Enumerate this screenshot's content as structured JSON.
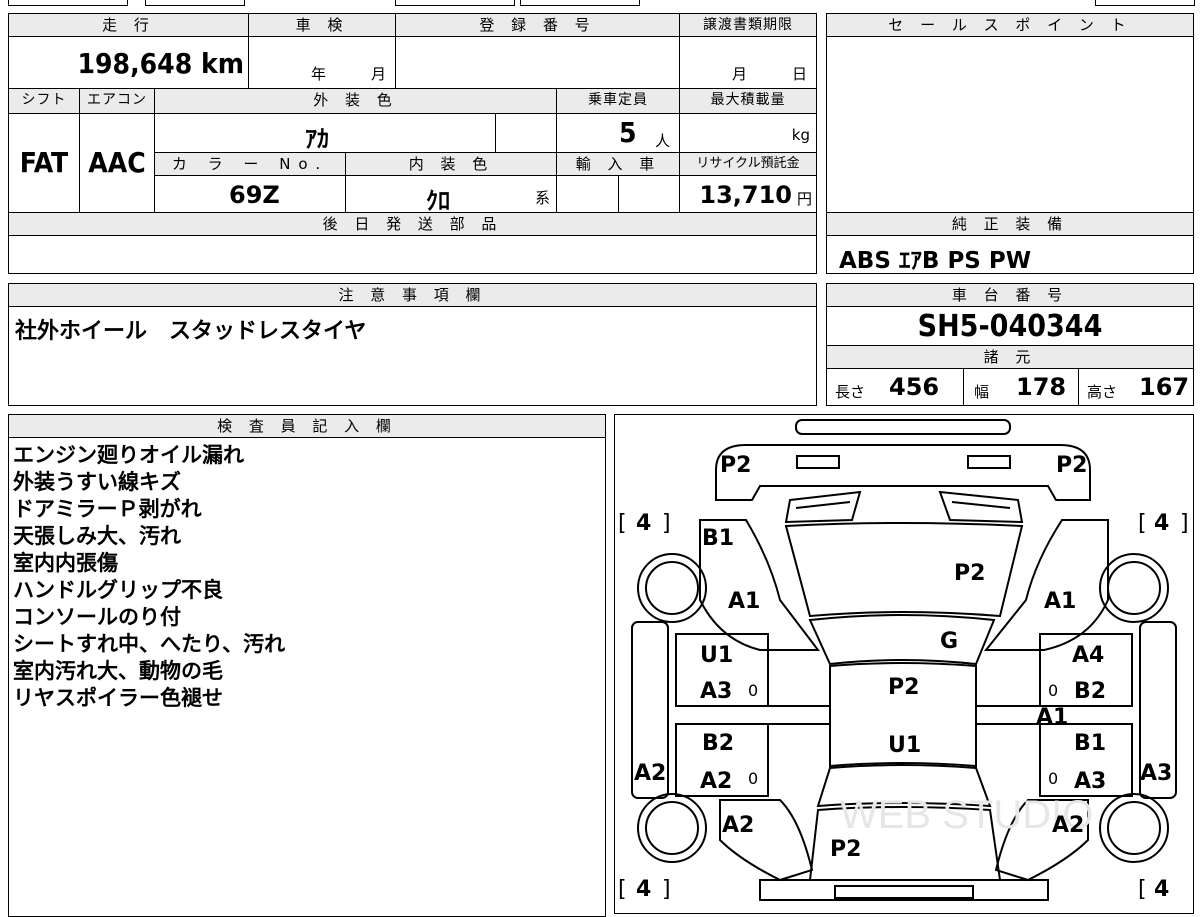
{
  "header": {
    "mileage_label": "走 行",
    "mileage_value": "198,648 km",
    "shaken_label": "車 検",
    "shaken_year_unit": "年",
    "shaken_month_unit": "月",
    "registration_label": "登 録 番 号",
    "transfer_label": "譲渡書類期限",
    "transfer_month_unit": "月",
    "transfer_day_unit": "日"
  },
  "specs": {
    "shift_label": "シフト",
    "shift_value": "FAT",
    "aircon_label": "エアコン",
    "aircon_value": "AAC",
    "exterior_color_label": "外 装 色",
    "exterior_color_value": "ｱｶ",
    "capacity_label": "乗車定員",
    "capacity_value": "5",
    "capacity_unit": "人",
    "max_load_label": "最大積載量",
    "max_load_unit": "kg",
    "color_no_label": "カ ラ ー No.",
    "color_no_value": "69Z",
    "interior_color_label": "内 装 色",
    "interior_color_value": "ｸﾛ",
    "interior_color_suffix": "系",
    "import_label": "輸 入 車",
    "recycle_label": "リサイクル預託金",
    "recycle_value": "13,710",
    "recycle_unit": "円"
  },
  "later_parts_label": "後 日 発 送 部 品",
  "sales_point_label": "セ ー ル ス ポ イ ン ト",
  "equipment_label": "純 正 装 備",
  "equipment_value": "ABS ｴｱB PS PW",
  "notes_label": "注 意 事 項 欄",
  "notes_value": "社外ホイール　スタッドレスタイヤ",
  "chassis_label": "車 台 番 号",
  "chassis_value": "SH5-040344",
  "dimensions_label": "諸 元",
  "dimensions": {
    "length_label": "長さ",
    "length_value": "456",
    "width_label": "幅",
    "width_value": "178",
    "height_label": "高さ",
    "height_value": "167"
  },
  "inspector_label": "検 査 員 記 入 欄",
  "inspector_notes": [
    "エンジン廻りオイル漏れ",
    "外装うすい線キズ",
    "ドアミラーＰ剥がれ",
    "天張しみ大、汚れ",
    "室内内張傷",
    "ハンドルグリップ不良",
    "コンソールのり付",
    "シートすれ中、へたり、汚れ",
    "室内汚れ大、動物の毛",
    "リヤスポイラー色褪せ"
  ],
  "diagram": {
    "marks": {
      "front_left_corner": "P2",
      "front_right_corner": "P2",
      "hood": "P2",
      "windshield": "G",
      "roof": "P2",
      "roof_lower": "U1",
      "rear": "P2",
      "left_fender": "B1",
      "left_fender_lower": "A1",
      "right_fender": "A1",
      "left_front_door_1": "U1",
      "left_front_door_2": "A3",
      "left_rear_door_1": "B2",
      "left_rear_door_2": "A2",
      "left_rocker": "A2",
      "left_quarter": "A2",
      "right_front_door_1": "A4",
      "right_front_door_2": "B2",
      "right_pillar": "A1",
      "right_rear_door_1": "B1",
      "right_rear_door_2": "A3",
      "right_rocker": "A3",
      "right_quarter": "A2",
      "tire_front_left": "4",
      "tire_front_right": "4",
      "tire_rear_left": "4",
      "tire_rear_right": "4",
      "glass_mark": "0"
    },
    "watermark": "WEB STUDIO"
  }
}
